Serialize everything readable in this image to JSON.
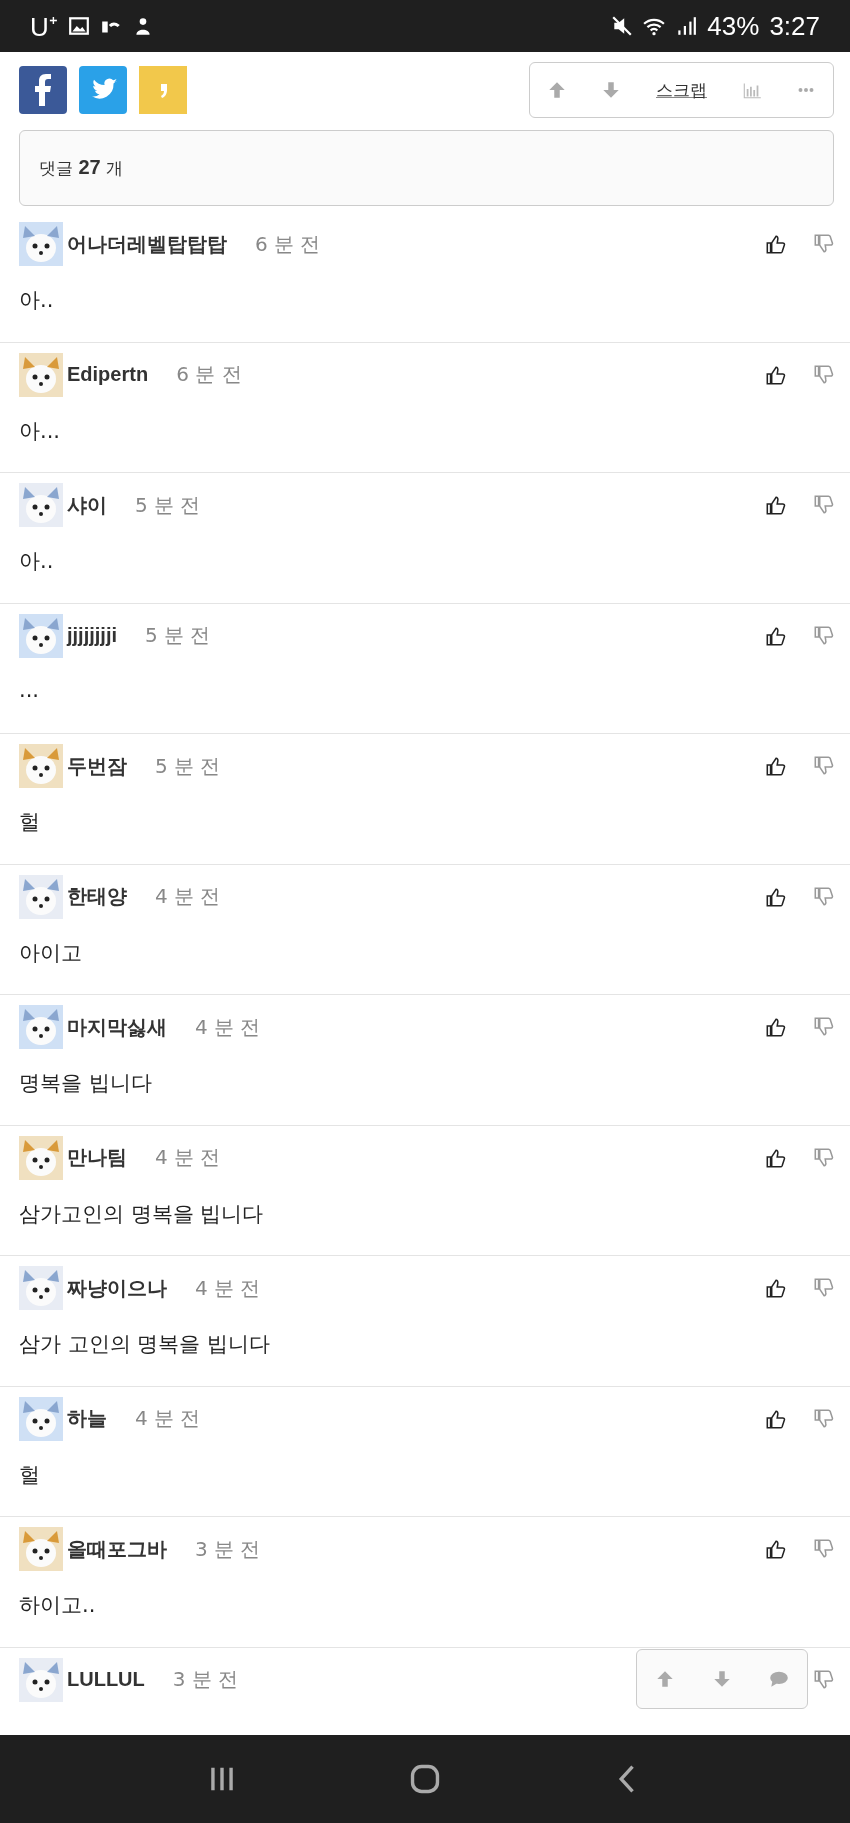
{
  "status_bar": {
    "carrier": "U⁺",
    "battery": "43%",
    "time": "3:27"
  },
  "toolbar": {
    "scrap": "스크랩"
  },
  "comment_count": {
    "label": "댓글",
    "count": "27",
    "unit": "개"
  },
  "comments": [
    {
      "author": "어나더레벨탑탑탑",
      "time": "6 분 전",
      "text": "아.."
    },
    {
      "author": "Edipertn",
      "time": "6 분 전",
      "text": "아..."
    },
    {
      "author": "샤이",
      "time": "5 분 전",
      "text": "아.."
    },
    {
      "author": "jjjjjjjji",
      "time": "5 분 전",
      "text": "..."
    },
    {
      "author": "두번잠",
      "time": "5 분 전",
      "text": "헐"
    },
    {
      "author": "한태양",
      "time": "4 분 전",
      "text": "아이고"
    },
    {
      "author": "마지막싫새",
      "time": "4 분 전",
      "text": "명복을 빕니다"
    },
    {
      "author": "만나팀",
      "time": "4 분 전",
      "text": "삼가고인의 명복을 빕니다"
    },
    {
      "author": "짜냥이으나",
      "time": "4 분 전",
      "text": "삼가 고인의 명복을 빕니다"
    },
    {
      "author": "하늘",
      "time": "4 분 전",
      "text": "헐"
    },
    {
      "author": "올때포그바",
      "time": "3 분 전",
      "text": "하이고.."
    },
    {
      "author": "LULLUL",
      "time": "3 분 전",
      "like_covered": true
    }
  ]
}
